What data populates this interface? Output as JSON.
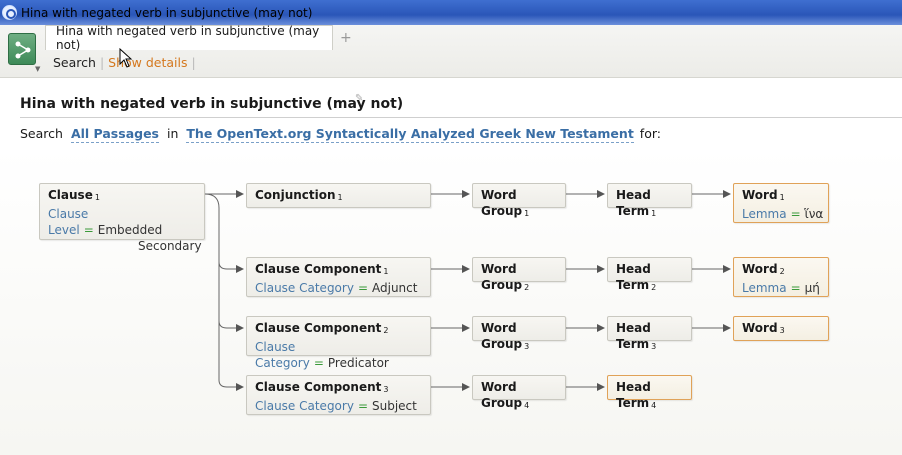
{
  "window": {
    "title": "Hina with negated verb in subjunctive (may not)"
  },
  "tabbar": {
    "tab_label": "Hina with negated verb in subjunctive (may not)",
    "add_tab": "+",
    "toolbar": {
      "search_label": "Search",
      "details_label": "Show details",
      "separator": "|"
    }
  },
  "page": {
    "title": "Hina with negated verb in subjunctive (may not)",
    "search_line": {
      "prefix": "Search",
      "passages": "All Passages",
      "in": "in",
      "resource": "The OpenText.org Syntactically Analyzed Greek New Testament",
      "suffix": "for:"
    }
  },
  "diagram": {
    "clause": {
      "name": "Clause",
      "num": "1",
      "prop": "Clause Level",
      "eq": "=",
      "val1": "Embedded",
      "val2": "Secondary"
    },
    "conjunction": {
      "name": "Conjunction",
      "num": "1"
    },
    "cc1": {
      "name": "Clause Component",
      "num": "1",
      "prop": "Clause Category",
      "eq": "=",
      "val": "Adjunct"
    },
    "cc2": {
      "name": "Clause Component",
      "num": "2",
      "prop": "Clause Category",
      "eq": "=",
      "val": "Predicator"
    },
    "cc3": {
      "name": "Clause Component",
      "num": "3",
      "prop": "Clause Category",
      "eq": "=",
      "val": "Subject"
    },
    "wg1": {
      "name": "Word Group",
      "num": "1"
    },
    "wg2": {
      "name": "Word Group",
      "num": "2"
    },
    "wg3": {
      "name": "Word Group",
      "num": "3"
    },
    "wg4": {
      "name": "Word Group",
      "num": "4"
    },
    "ht1": {
      "name": "Head Term",
      "num": "1"
    },
    "ht2": {
      "name": "Head Term",
      "num": "2"
    },
    "ht3": {
      "name": "Head Term",
      "num": "3"
    },
    "ht4": {
      "name": "Head Term",
      "num": "4"
    },
    "w1": {
      "name": "Word",
      "num": "1",
      "prop": "Lemma",
      "eq": "=",
      "val": "ἵνα"
    },
    "w2": {
      "name": "Word",
      "num": "2",
      "prop": "Lemma",
      "eq": "=",
      "val": "μή"
    },
    "w3": {
      "name": "Word",
      "num": "3"
    },
    "icons": {
      "panel": "search-panel-icon",
      "edit": "pencil-icon",
      "app": "logos-app-icon"
    },
    "colors": {
      "link": "#3a6ea5",
      "highlight_border": "#e0a258",
      "details": "#d4781e"
    }
  }
}
